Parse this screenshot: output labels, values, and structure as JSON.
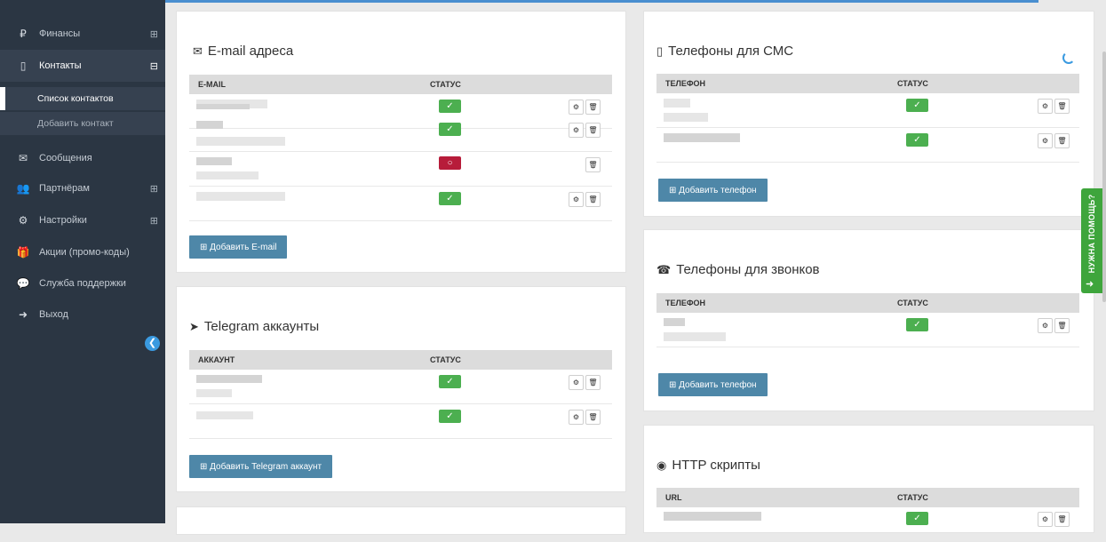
{
  "sidebar": {
    "items": [
      {
        "label": "Финансы",
        "icon": "ruble-icon",
        "expand": "⊞"
      },
      {
        "label": "Контакты",
        "icon": "mobile-icon",
        "expand": "⊟"
      },
      {
        "label": "Сообщения",
        "icon": "envelope-icon"
      },
      {
        "label": "Партнёрам",
        "icon": "users-icon",
        "expand": "⊞"
      },
      {
        "label": "Настройки",
        "icon": "gear-icon",
        "expand": "⊞"
      },
      {
        "label": "Акции (промо-коды)",
        "icon": "gift-icon"
      },
      {
        "label": "Служба поддержки",
        "icon": "chat-icon"
      },
      {
        "label": "Выход",
        "icon": "exit-icon"
      }
    ],
    "subitems": [
      {
        "label": "Список контактов"
      },
      {
        "label": "Добавить контакт"
      }
    ]
  },
  "email": {
    "title": "E-mail адреса",
    "col_email": "E-MAIL",
    "col_status": "СТАТУС",
    "add_label": "⊞ Добавить E-mail"
  },
  "telegram": {
    "title": "Telegram аккаунты",
    "col_account": "АККАУНТ",
    "col_status": "СТАТУС",
    "add_label": "⊞ Добавить Telegram аккаунт"
  },
  "sms": {
    "title": "Телефоны для СМС",
    "col_phone": "ТЕЛЕФОН",
    "col_status": "СТАТУС",
    "add_label": "⊞ Добавить телефон"
  },
  "calls": {
    "title": "Телефоны для звонков",
    "col_phone": "ТЕЛЕФОН",
    "col_status": "СТАТУС",
    "add_label": "⊞ Добавить телефон"
  },
  "http": {
    "title": "HTTP скрипты",
    "col_url": "URL",
    "col_status": "СТАТУС"
  },
  "help_tab": {
    "label": "НУЖНА ПОМОЩЬ?"
  },
  "colors": {
    "sidebar": "#2b3643",
    "accent": "#3a9ae0",
    "ok": "#4caf50",
    "bad": "#b71c3a",
    "button": "#4e87a8",
    "help": "#3ea53c"
  }
}
